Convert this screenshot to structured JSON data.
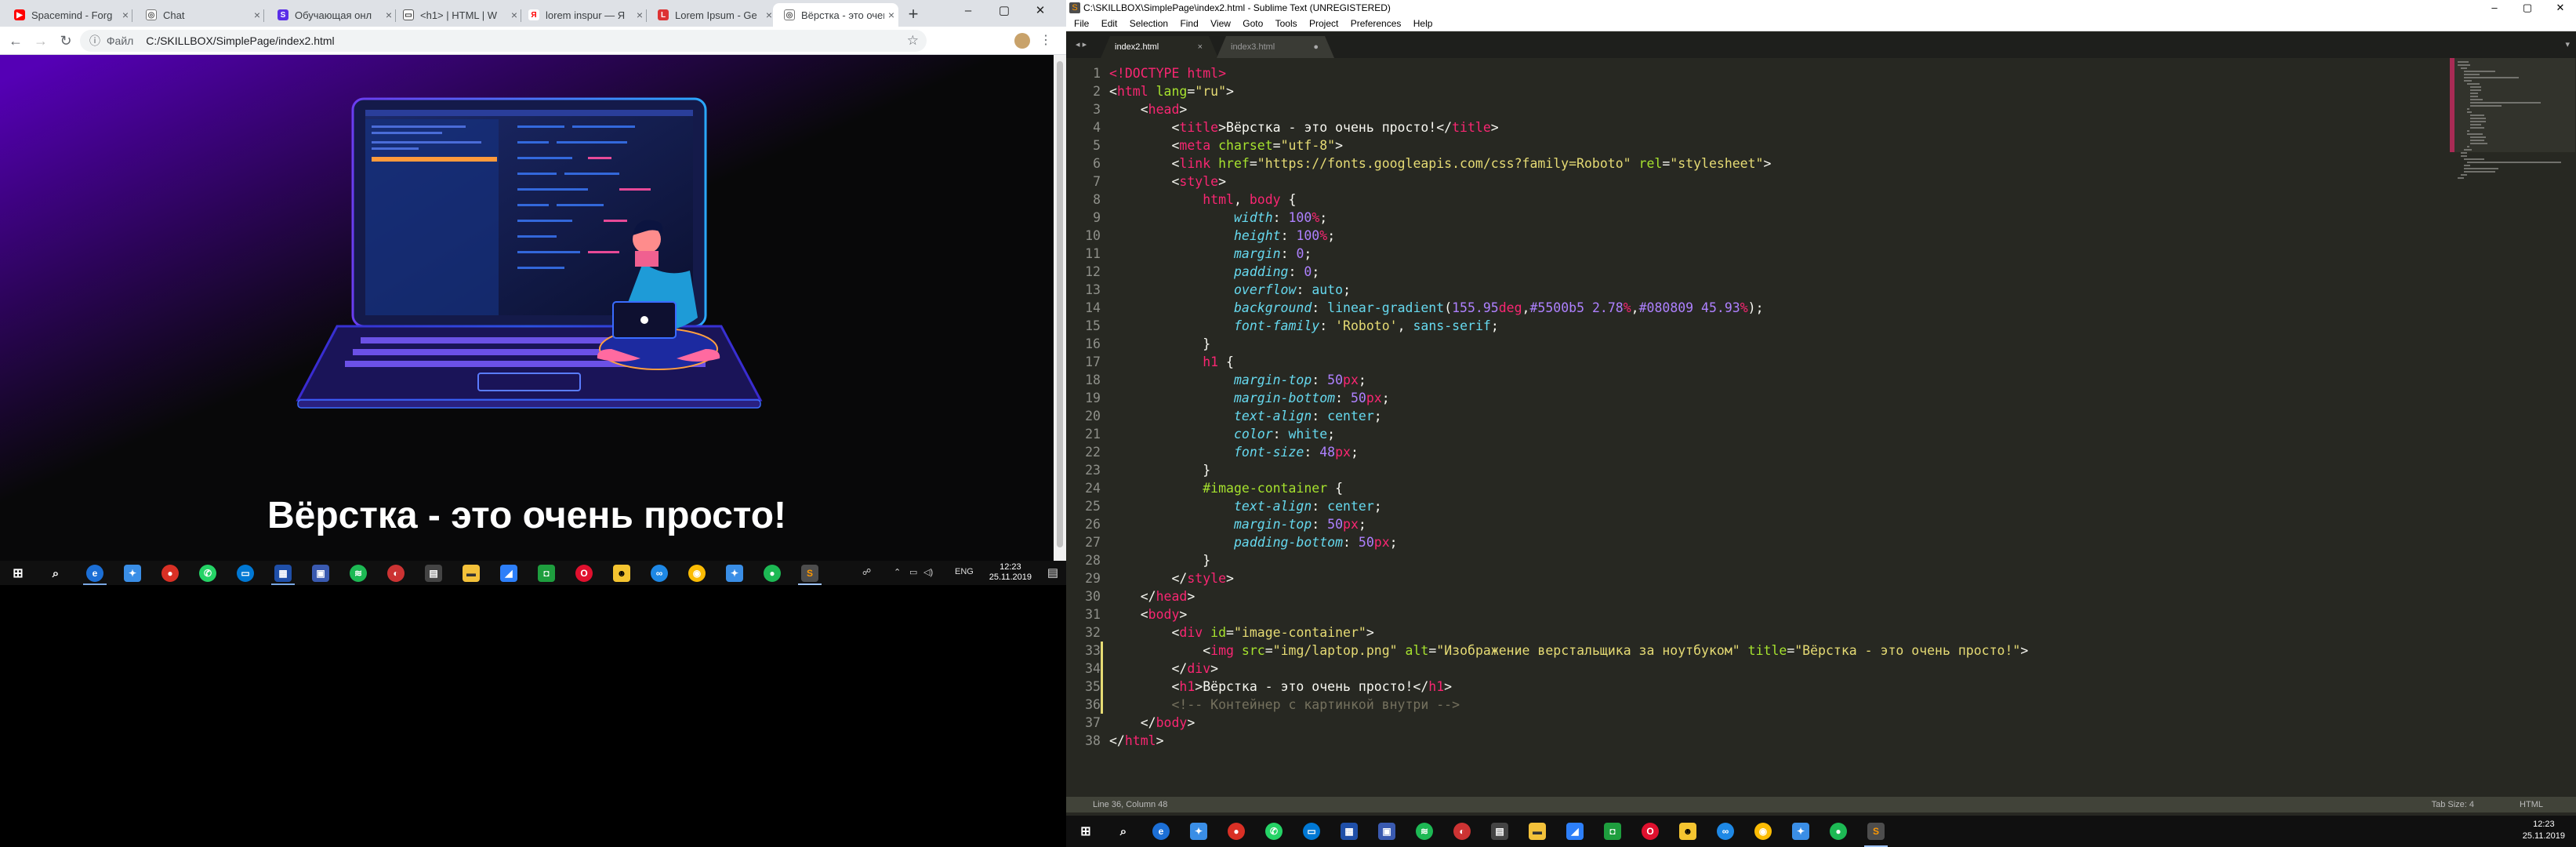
{
  "browser": {
    "tabs": [
      {
        "label": "Spacemind - Forg",
        "icon": "youtube-icon",
        "color": "#ff0000"
      },
      {
        "label": "Chat",
        "icon": "globe-icon",
        "color": "#5f6368"
      },
      {
        "label": "Обучающая онл",
        "icon": "skillbox-icon",
        "color": "#5a2ee8"
      },
      {
        "label": "<h1> | HTML | W",
        "icon": "chat-bubble-icon",
        "color": "#5f6368"
      },
      {
        "label": "lorem inspur — Я",
        "icon": "yandex-icon",
        "color": "#ff0000"
      },
      {
        "label": "Lorem Ipsum - Ge",
        "icon": "lorem-icon",
        "color": "#d33"
      },
      {
        "label": "Вёрстка - это очень",
        "icon": "globe-icon",
        "color": "#5f6368"
      }
    ],
    "address": {
      "prefix": "Файл",
      "path": "C:/SKILLBOX/SimplePage/index2.html"
    },
    "page": {
      "heading": "Вёрстка - это очень просто!"
    }
  },
  "taskbar_left": {
    "lang": "ENG",
    "time": "12:23",
    "date": "25.11.2019"
  },
  "sublime": {
    "title": "C:\\SKILLBOX\\SimplePage\\index2.html - Sublime Text (UNREGISTERED)",
    "menu": [
      "File",
      "Edit",
      "Selection",
      "Find",
      "View",
      "Goto",
      "Tools",
      "Project",
      "Preferences",
      "Help"
    ],
    "tabs": [
      {
        "label": "index2.html",
        "active": true
      },
      {
        "label": "index3.html",
        "active": false
      }
    ],
    "lines": [
      [
        [
          "t",
          "<!DOCTYPE html>"
        ]
      ],
      [
        [
          "w",
          "<"
        ],
        [
          "t",
          "html"
        ],
        [
          "a",
          " lang"
        ],
        [
          "w",
          "="
        ],
        [
          "s",
          "\"ru\""
        ],
        [
          "w",
          ">"
        ]
      ],
      [
        [
          "w",
          "    <"
        ],
        [
          "t",
          "head"
        ],
        [
          "w",
          ">"
        ]
      ],
      [
        [
          "w",
          "        <"
        ],
        [
          "t",
          "title"
        ],
        [
          "w",
          ">Вёрстка - это очень просто!</"
        ],
        [
          "t",
          "title"
        ],
        [
          "w",
          ">"
        ]
      ],
      [
        [
          "w",
          "        <"
        ],
        [
          "t",
          "meta"
        ],
        [
          "a",
          " charset"
        ],
        [
          "w",
          "="
        ],
        [
          "s",
          "\"utf-8\""
        ],
        [
          "w",
          ">"
        ]
      ],
      [
        [
          "w",
          "        <"
        ],
        [
          "t",
          "link"
        ],
        [
          "a",
          " href"
        ],
        [
          "w",
          "="
        ],
        [
          "s",
          "\"https://fonts.googleapis.com/css?family=Roboto\""
        ],
        [
          "a",
          " rel"
        ],
        [
          "w",
          "="
        ],
        [
          "s",
          "\"stylesheet\""
        ],
        [
          "w",
          ">"
        ]
      ],
      [
        [
          "w",
          "        <"
        ],
        [
          "t",
          "style"
        ],
        [
          "w",
          ">"
        ]
      ],
      [
        [
          "w",
          "            "
        ],
        [
          "t",
          "html"
        ],
        [
          "w",
          ", "
        ],
        [
          "t",
          "body"
        ],
        [
          "w",
          " {"
        ]
      ],
      [
        [
          "w",
          "                "
        ],
        [
          "p",
          "width"
        ],
        [
          "w",
          ": "
        ],
        [
          "n",
          "100"
        ],
        [
          "u",
          "%"
        ],
        [
          "w",
          ";"
        ]
      ],
      [
        [
          "w",
          "                "
        ],
        [
          "p",
          "height"
        ],
        [
          "w",
          ": "
        ],
        [
          "n",
          "100"
        ],
        [
          "u",
          "%"
        ],
        [
          "w",
          ";"
        ]
      ],
      [
        [
          "w",
          "                "
        ],
        [
          "p",
          "margin"
        ],
        [
          "w",
          ": "
        ],
        [
          "n",
          "0"
        ],
        [
          "w",
          ";"
        ]
      ],
      [
        [
          "w",
          "                "
        ],
        [
          "p",
          "padding"
        ],
        [
          "w",
          ": "
        ],
        [
          "n",
          "0"
        ],
        [
          "w",
          ";"
        ]
      ],
      [
        [
          "w",
          "                "
        ],
        [
          "p",
          "overflow"
        ],
        [
          "w",
          ": "
        ],
        [
          "v",
          "auto"
        ],
        [
          "w",
          ";"
        ]
      ],
      [
        [
          "w",
          "                "
        ],
        [
          "p",
          "background"
        ],
        [
          "w",
          ": "
        ],
        [
          "v",
          "linear-gradient"
        ],
        [
          "w",
          "("
        ],
        [
          "n",
          "155.95"
        ],
        [
          "u",
          "deg"
        ],
        [
          "w",
          ","
        ],
        [
          "n",
          "#5500b5 2.78"
        ],
        [
          "u",
          "%"
        ],
        [
          "w",
          ","
        ],
        [
          "n",
          "#080809 45.93"
        ],
        [
          "u",
          "%"
        ],
        [
          "w",
          ");"
        ]
      ],
      [
        [
          "w",
          "                "
        ],
        [
          "p",
          "font-family"
        ],
        [
          "w",
          ": "
        ],
        [
          "s",
          "'Roboto'"
        ],
        [
          "w",
          ", "
        ],
        [
          "v",
          "sans-serif"
        ],
        [
          "w",
          ";"
        ]
      ],
      [
        [
          "w",
          "            }"
        ]
      ],
      [
        [
          "w",
          "            "
        ],
        [
          "t",
          "h1"
        ],
        [
          "w",
          " {"
        ]
      ],
      [
        [
          "w",
          "                "
        ],
        [
          "p",
          "margin-top"
        ],
        [
          "w",
          ": "
        ],
        [
          "n",
          "50"
        ],
        [
          "u",
          "px"
        ],
        [
          "w",
          ";"
        ]
      ],
      [
        [
          "w",
          "                "
        ],
        [
          "p",
          "margin-bottom"
        ],
        [
          "w",
          ": "
        ],
        [
          "n",
          "50"
        ],
        [
          "u",
          "px"
        ],
        [
          "w",
          ";"
        ]
      ],
      [
        [
          "w",
          "                "
        ],
        [
          "p",
          "text-align"
        ],
        [
          "w",
          ": "
        ],
        [
          "v",
          "center"
        ],
        [
          "w",
          ";"
        ]
      ],
      [
        [
          "w",
          "                "
        ],
        [
          "p",
          "color"
        ],
        [
          "w",
          ": "
        ],
        [
          "v",
          "white"
        ],
        [
          "w",
          ";"
        ]
      ],
      [
        [
          "w",
          "                "
        ],
        [
          "p",
          "font-size"
        ],
        [
          "w",
          ": "
        ],
        [
          "n",
          "48"
        ],
        [
          "u",
          "px"
        ],
        [
          "w",
          ";"
        ]
      ],
      [
        [
          "w",
          "            }"
        ]
      ],
      [
        [
          "w",
          "            "
        ],
        [
          "a",
          "#image-container"
        ],
        [
          "w",
          " {"
        ]
      ],
      [
        [
          "w",
          "                "
        ],
        [
          "p",
          "text-align"
        ],
        [
          "w",
          ": "
        ],
        [
          "v",
          "center"
        ],
        [
          "w",
          ";"
        ]
      ],
      [
        [
          "w",
          "                "
        ],
        [
          "p",
          "margin-top"
        ],
        [
          "w",
          ": "
        ],
        [
          "n",
          "50"
        ],
        [
          "u",
          "px"
        ],
        [
          "w",
          ";"
        ]
      ],
      [
        [
          "w",
          "                "
        ],
        [
          "p",
          "padding-bottom"
        ],
        [
          "w",
          ": "
        ],
        [
          "n",
          "50"
        ],
        [
          "u",
          "px"
        ],
        [
          "w",
          ";"
        ]
      ],
      [
        [
          "w",
          "            }"
        ]
      ],
      [
        [
          "w",
          "        </"
        ],
        [
          "t",
          "style"
        ],
        [
          "w",
          ">"
        ]
      ],
      [
        [
          "w",
          "    </"
        ],
        [
          "t",
          "head"
        ],
        [
          "w",
          ">"
        ]
      ],
      [
        [
          "w",
          "    <"
        ],
        [
          "t",
          "body"
        ],
        [
          "w",
          ">"
        ]
      ],
      [
        [
          "w",
          "        <"
        ],
        [
          "t",
          "div"
        ],
        [
          "a",
          " id"
        ],
        [
          "w",
          "="
        ],
        [
          "s",
          "\"image-container\""
        ],
        [
          "w",
          ">"
        ]
      ],
      [
        [
          "w",
          "            <"
        ],
        [
          "t",
          "img"
        ],
        [
          "a",
          " src"
        ],
        [
          "w",
          "="
        ],
        [
          "s",
          "\"img/laptop.png\""
        ],
        [
          "a",
          " alt"
        ],
        [
          "w",
          "="
        ],
        [
          "s",
          "\"Изображение верстальщика за ноутбуком\""
        ],
        [
          "a",
          " title"
        ],
        [
          "w",
          "="
        ],
        [
          "s",
          "\"Вёрстка - это очень просто!\""
        ],
        [
          "w",
          ">"
        ]
      ],
      [
        [
          "w",
          "        </"
        ],
        [
          "t",
          "div"
        ],
        [
          "w",
          ">"
        ]
      ],
      [
        [
          "w",
          "        <"
        ],
        [
          "t",
          "h1"
        ],
        [
          "w",
          ">Вёрстка - это очень просто!</"
        ],
        [
          "t",
          "h1"
        ],
        [
          "w",
          ">"
        ]
      ],
      [
        [
          "c",
          "        <!-- Контейнер с картинкой внутри -->"
        ]
      ],
      [
        [
          "w",
          "    </"
        ],
        [
          "t",
          "body"
        ],
        [
          "w",
          ">"
        ]
      ],
      [
        [
          "w",
          "</"
        ],
        [
          "t",
          "html"
        ],
        [
          "w",
          ">"
        ]
      ]
    ],
    "status": {
      "position": "Line 36, Column 48",
      "tab_size": "Tab Size: 4",
      "syntax": "HTML"
    }
  },
  "taskbar_right": {
    "time": "12:23",
    "date": "25.11.2019"
  }
}
